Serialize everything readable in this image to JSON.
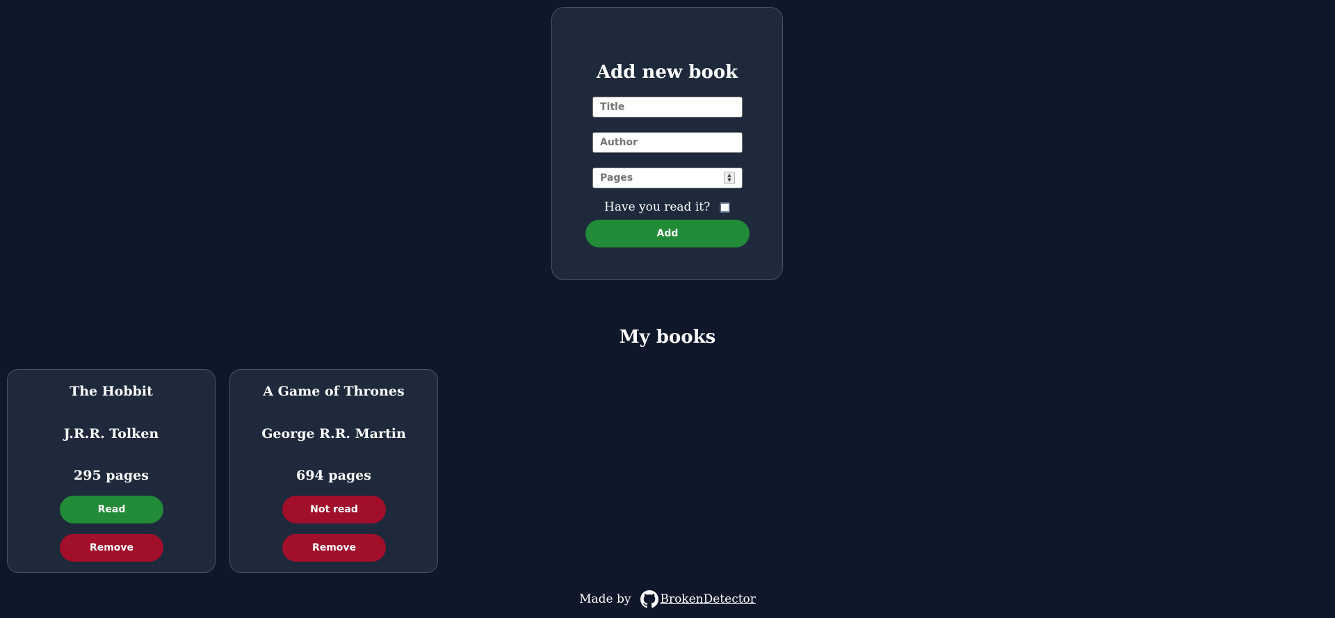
{
  "form": {
    "title": "Add new book",
    "title_placeholder": "Title",
    "author_placeholder": "Author",
    "pages_placeholder": "Pages",
    "read_label": "Have you read it?",
    "read_checked": false,
    "add_label": "Add"
  },
  "library": {
    "heading": "My books",
    "books": [
      {
        "title": "The Hobbit",
        "author": "J.R.R. Tolken",
        "pages": "295 pages",
        "status_label": "Read",
        "remove_label": "Remove",
        "status_color": "#228b38"
      },
      {
        "title": "A Game of Thrones",
        "author": "George R.R. Martin",
        "pages": "694 pages",
        "status_label": "Not read",
        "remove_label": "Remove",
        "status_color": "#a10f2b"
      }
    ]
  },
  "footer": {
    "made_by": "Made by",
    "author": "BrokenDetector",
    "icon": "github-icon"
  },
  "colors": {
    "background": "#0f172a",
    "card": "#1e293b",
    "card_border": "#475569",
    "green": "#228b38",
    "red": "#a10f2b"
  }
}
